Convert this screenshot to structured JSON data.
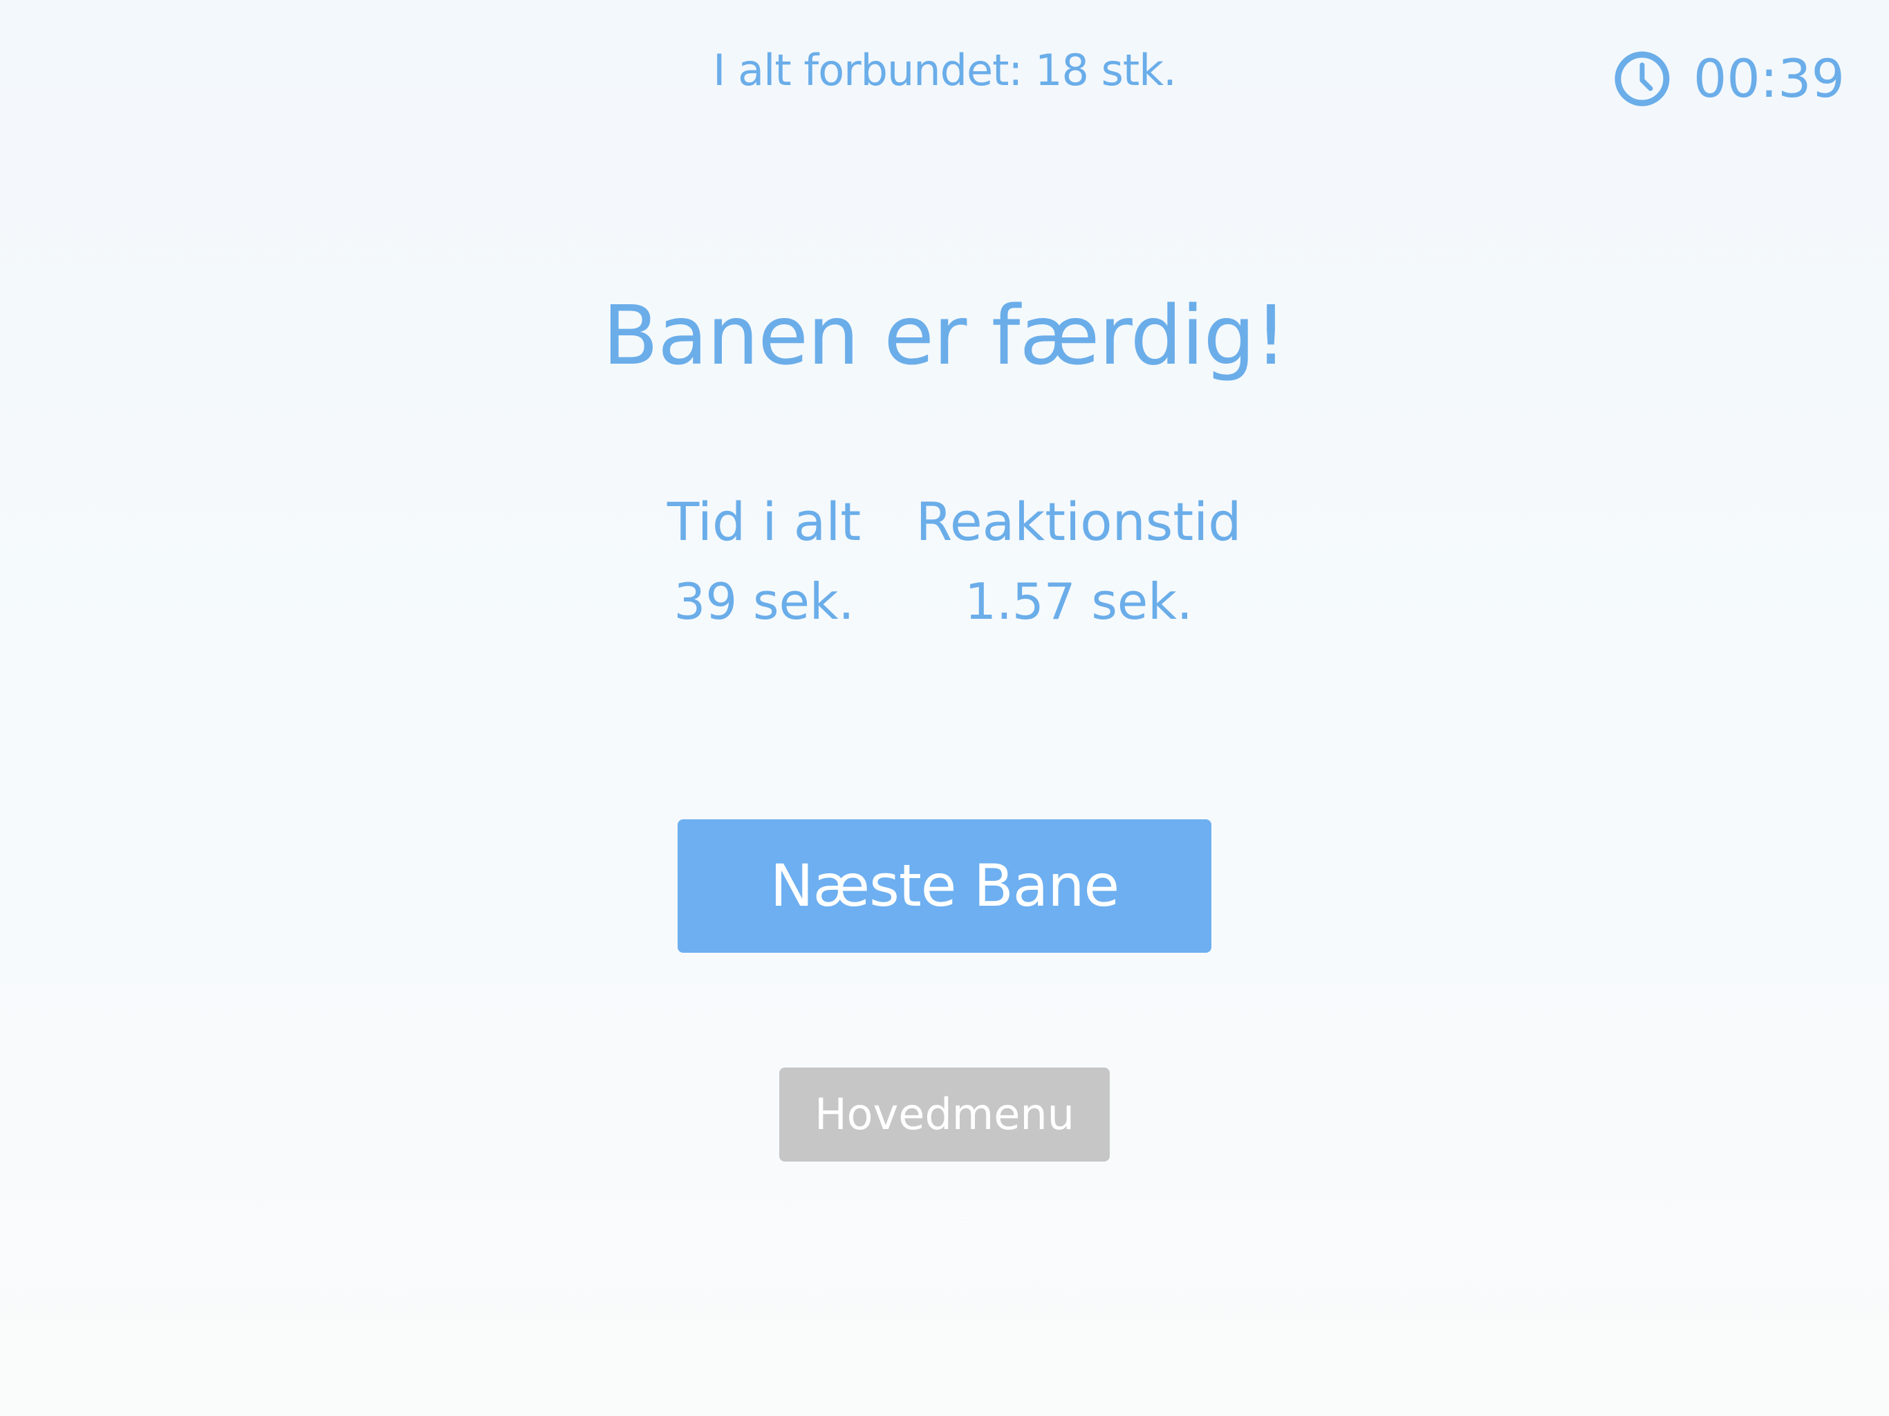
{
  "header": {
    "connected_total": "I alt forbundet: 18 stk.",
    "timer": "00:39",
    "timer_icon": "clock-icon"
  },
  "result": {
    "title": "Banen er færdig!",
    "stats": [
      {
        "label": "Tid i alt",
        "value": "39 sek."
      },
      {
        "label": "Reaktionstid",
        "value": "1.57 sek."
      }
    ]
  },
  "actions": {
    "next_level_label": "Næste Bane",
    "main_menu_label": "Hovedmenu"
  },
  "colors": {
    "accent": "#6aade9",
    "primary_button": "#6daff0",
    "secondary_button": "#c6c6c6",
    "background": "#f5f9fc"
  }
}
